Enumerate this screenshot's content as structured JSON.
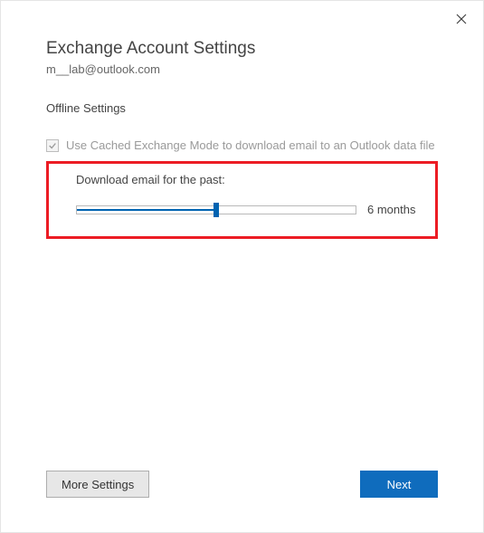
{
  "dialog": {
    "title": "Exchange Account Settings",
    "email": "m__lab@outlook.com"
  },
  "offline": {
    "section_label": "Offline Settings",
    "cached_mode_label": "Use Cached Exchange Mode to download email to an Outlook data file",
    "cached_mode_checked": true
  },
  "slider": {
    "label": "Download email for the past:",
    "value_label": "6 months",
    "percent": 50
  },
  "footer": {
    "more_settings": "More Settings",
    "next": "Next"
  }
}
